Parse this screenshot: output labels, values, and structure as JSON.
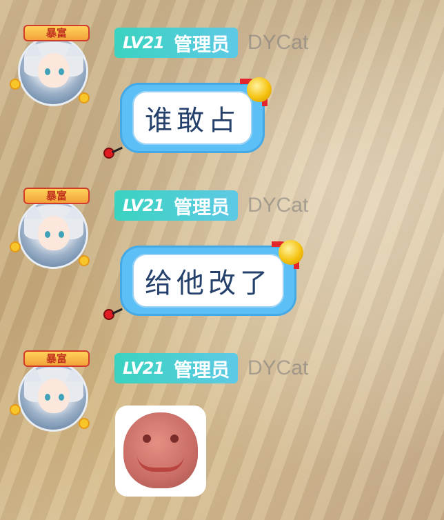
{
  "messages": [
    {
      "level": "LV21",
      "role": "管理员",
      "nickname": "DYCat",
      "frame_label": "暴富",
      "text": "谁敢占",
      "type": "text"
    },
    {
      "level": "LV21",
      "role": "管理员",
      "nickname": "DYCat",
      "frame_label": "暴富",
      "text": "给他改了",
      "type": "text"
    },
    {
      "level": "LV21",
      "role": "管理员",
      "nickname": "DYCat",
      "frame_label": "暴富",
      "type": "sticker",
      "sticker_icon": "smiling-face-sticker"
    }
  ],
  "colors": {
    "badge_gradient_start": "#3ad3c0",
    "badge_gradient_end": "#5ec9e5",
    "bubble_border": "#5cc0f6",
    "bubble_text": "#24406b",
    "nickname": "#9a9a9a"
  }
}
